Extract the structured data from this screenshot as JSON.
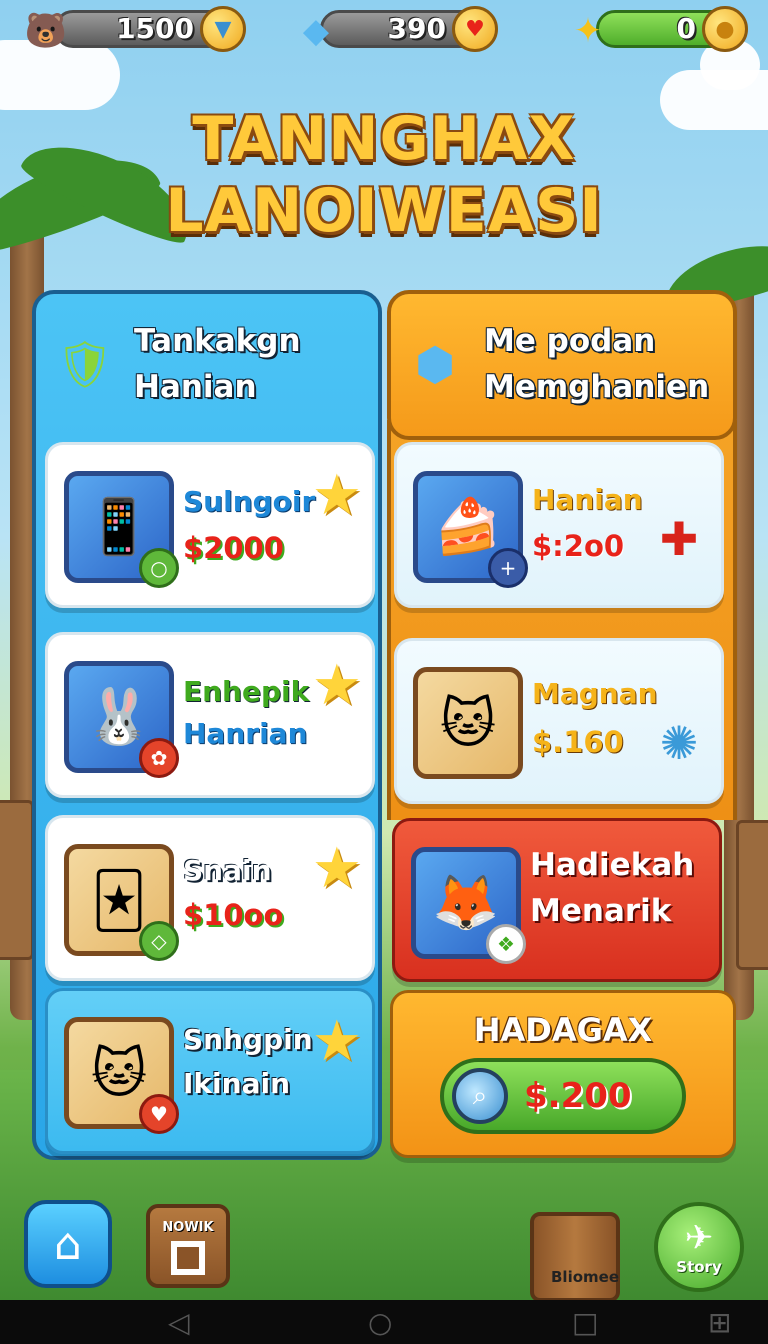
{
  "currencies": [
    {
      "value": "1500",
      "icon": "bear-icon",
      "coin_icon": "diamond-coin-icon"
    },
    {
      "value": "390",
      "icon": "blue-gem-icon",
      "coin_icon": "heart-coin-icon"
    },
    {
      "value": "0",
      "icon": "gold-nugget-icon",
      "coin_icon": "gold-coin-icon"
    }
  ],
  "title": {
    "line1": "TANNGHAX",
    "line2": "LANOIWEASI"
  },
  "left_panel": {
    "heading_line1": "Tankakgn",
    "heading_line2": "Hanian",
    "items": [
      {
        "name": "Sulngoir",
        "price": "$2000",
        "name_color": "#1e88d8"
      },
      {
        "name_line1": "Enhepik",
        "name_line2": "Hanrian",
        "name_color": "#3faa1e"
      },
      {
        "name": "Snain",
        "price": "$10oo"
      },
      {
        "name_line1": "Snhgpin",
        "name_line2": "Ikinain"
      }
    ]
  },
  "right_panel": {
    "heading_line1": "Me podan",
    "heading_line2": "Memghanien",
    "items": [
      {
        "name": "Hanian",
        "price": "$:2o0"
      },
      {
        "name": "Magnan",
        "price": "$.160"
      },
      {
        "name_line1": "Hadiekah",
        "name_line2": "Menarik"
      }
    ],
    "promo": {
      "label": "HADAGAX",
      "price": "$.200"
    }
  },
  "bottom_nav": {
    "nowik_label": "NOWIK",
    "bliomee_label": "Bliomee",
    "story_label": "Story"
  }
}
